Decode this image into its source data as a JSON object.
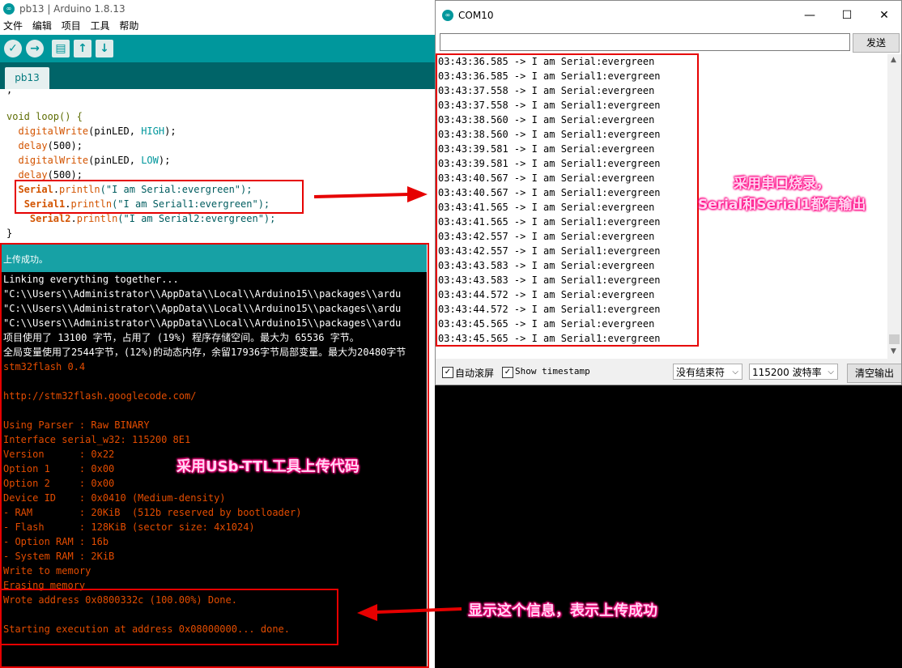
{
  "ide": {
    "title": "pb13 | Arduino 1.8.13",
    "menu": [
      "文件",
      "编辑",
      "项目",
      "工具",
      "帮助"
    ],
    "toolbar": {
      "verify_icon": "check-icon",
      "upload_icon": "arrow-right-icon",
      "new_icon": "file-icon",
      "open_icon": "arrow-up-icon",
      "save_icon": "arrow-down-icon"
    },
    "tab": "pb13",
    "code_lines": [
      {
        "text": "void loop() {"
      },
      {
        "indent": "  ",
        "fn": "digitalWrite",
        "rest_a": "(pinLED, ",
        "const": "HIGH",
        "rest_b": ");"
      },
      {
        "indent": "  ",
        "fn": "delay",
        "rest_a": "(500);"
      },
      {
        "indent": "  ",
        "fn": "digitalWrite",
        "rest_a": "(pinLED, ",
        "const": "LOW",
        "rest_b": ");"
      },
      {
        "indent": "  ",
        "fn": "delay",
        "rest_a": "(500);"
      },
      {
        "indent": "  ",
        "obj": "Serial",
        "dot": ".",
        "fn": "println",
        "rest_a": "(\"I am Serial:evergreen\");"
      },
      {
        "indent": "   ",
        "obj": "Serial1",
        "dot": ".",
        "fn": "println",
        "rest_a": "(\"I am Serial1:evergreen\");"
      },
      {
        "indent": "    ",
        "obj": "Serial2",
        "dot": ".",
        "fn": "println",
        "rest_a": "(\"I am Serial2:evergreen\");"
      },
      {
        "text": "}"
      }
    ],
    "status": "上传成功。",
    "console": [
      {
        "text": "Linking everything together...",
        "color": "white"
      },
      {
        "text": "\"C:\\\\Users\\\\Administrator\\\\AppData\\\\Local\\\\Arduino15\\\\packages\\\\ardu",
        "color": "white"
      },
      {
        "text": "\"C:\\\\Users\\\\Administrator\\\\AppData\\\\Local\\\\Arduino15\\\\packages\\\\ardu",
        "color": "white"
      },
      {
        "text": "\"C:\\\\Users\\\\Administrator\\\\AppData\\\\Local\\\\Arduino15\\\\packages\\\\ardu",
        "color": "white"
      },
      {
        "text": "项目使用了 13100 字节，占用了 (19%) 程序存储空间。最大为 65536 字节。",
        "color": "white"
      },
      {
        "text": "全局变量使用了2544字节，(12%)的动态内存，余留17936字节局部变量。最大为20480字节",
        "color": "white"
      },
      {
        "text": "stm32flash 0.4",
        "color": "orange"
      },
      {
        "text": "",
        "color": "orange"
      },
      {
        "text": "http://stm32flash.googlecode.com/",
        "color": "orange"
      },
      {
        "text": "",
        "color": "orange"
      },
      {
        "text": "Using Parser : Raw BINARY",
        "color": "orange"
      },
      {
        "text": "Interface serial_w32: 115200 8E1",
        "color": "orange"
      },
      {
        "text": "Version      : 0x22",
        "color": "orange"
      },
      {
        "text": "Option 1     : 0x00",
        "color": "orange"
      },
      {
        "text": "Option 2     : 0x00",
        "color": "orange"
      },
      {
        "text": "Device ID    : 0x0410 (Medium-density)",
        "color": "orange"
      },
      {
        "text": "- RAM        : 20KiB  (512b reserved by bootloader)",
        "color": "orange"
      },
      {
        "text": "- Flash      : 128KiB (sector size: 4x1024)",
        "color": "orange"
      },
      {
        "text": "- Option RAM : 16b",
        "color": "orange"
      },
      {
        "text": "- System RAM : 2KiB",
        "color": "orange"
      },
      {
        "text": "Write to memory",
        "color": "orange"
      },
      {
        "text": "Erasing memory",
        "color": "orange"
      },
      {
        "text": "Wrote address 0x0800332c (100.00%) Done.",
        "color": "orange"
      },
      {
        "text": "",
        "color": "orange"
      },
      {
        "text": "Starting execution at address 0x08000000... done.",
        "color": "orange"
      }
    ]
  },
  "serial_monitor": {
    "title": "COM10",
    "controls": {
      "minimize": "—",
      "maximize": "☐",
      "close": "✕"
    },
    "input_value": "",
    "send_label": "发送",
    "lines": [
      "03:43:36.585 -> I am Serial:evergreen",
      "03:43:36.585 -> I am Serial1:evergreen",
      "03:43:37.558 -> I am Serial:evergreen",
      "03:43:37.558 -> I am Serial1:evergreen",
      "03:43:38.560 -> I am Serial:evergreen",
      "03:43:38.560 -> I am Serial1:evergreen",
      "03:43:39.581 -> I am Serial:evergreen",
      "03:43:39.581 -> I am Serial1:evergreen",
      "03:43:40.567 -> I am Serial:evergreen",
      "03:43:40.567 -> I am Serial1:evergreen",
      "03:43:41.565 -> I am Serial:evergreen",
      "03:43:41.565 -> I am Serial1:evergreen",
      "03:43:42.557 -> I am Serial:evergreen",
      "03:43:42.557 -> I am Serial1:evergreen",
      "03:43:43.583 -> I am Serial:evergreen",
      "03:43:43.583 -> I am Serial1:evergreen",
      "03:43:44.572 -> I am Serial:evergreen",
      "03:43:44.572 -> I am Serial1:evergreen",
      "03:43:45.565 -> I am Serial:evergreen",
      "03:43:45.565 -> I am Serial1:evergreen"
    ],
    "autoscroll_label": "自动滚屏",
    "autoscroll_checked": true,
    "timestamp_label": "Show timestamp",
    "timestamp_checked": true,
    "line_ending": "没有结束符",
    "baud_rate": "115200 波特率",
    "clear_label": "清空输出"
  },
  "annotations": {
    "serial_note_line1": "采用串口烧录，",
    "serial_note_line2": "Serial和Serial1都有输出",
    "upload_note": "采用USb-TTL工具上传代码",
    "success_note": "显示这个信息，表示上传成功"
  },
  "colors": {
    "arduino_teal": "#00979c",
    "annotation_red": "#e60000",
    "console_orange": "#e34c00",
    "callout_pink": "#ff0080"
  }
}
